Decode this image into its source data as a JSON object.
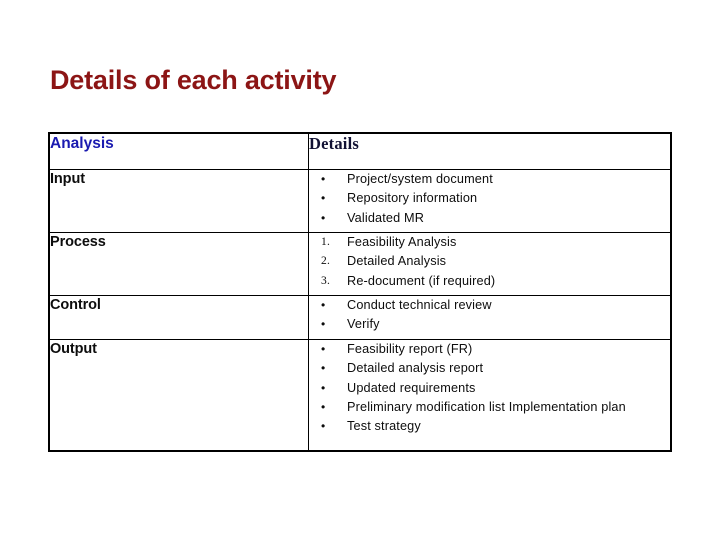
{
  "slide": {
    "title": "Details of each activity",
    "title_color": "#8c1515",
    "background": "#ffffff"
  },
  "table": {
    "header": {
      "col1": "Analysis",
      "col2": "Details",
      "col1_color": "#1a1ab0",
      "col2_color": "#111133"
    },
    "rows": [
      {
        "label": "Input",
        "list_type": "bullet",
        "items": [
          "Project/system document",
          "Repository information",
          "Validated MR"
        ]
      },
      {
        "label": "Process",
        "list_type": "numbered",
        "items": [
          "Feasibility Analysis",
          "Detailed Analysis",
          "Re-document (if required)"
        ],
        "markers": [
          "1.",
          "2.",
          "3."
        ]
      },
      {
        "label": "Control",
        "list_type": "bullet",
        "items": [
          "Conduct technical review",
          "Verify"
        ]
      },
      {
        "label": "Output",
        "list_type": "bullet",
        "items": [
          "Feasibility report (FR)",
          "Detailed analysis report",
          "Updated requirements",
          "Preliminary modification list Implementation plan",
          "Test strategy"
        ]
      }
    ],
    "bullet_glyph": "•",
    "border_color": "#000000"
  }
}
